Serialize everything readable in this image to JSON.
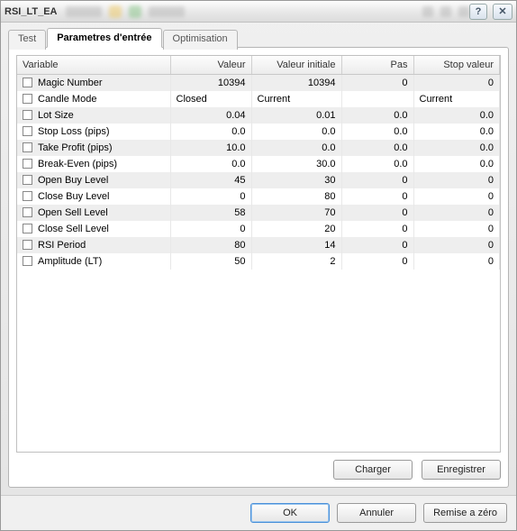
{
  "window": {
    "title": "RSI_LT_EA"
  },
  "tabs": {
    "test": "Test",
    "params": "Parametres d'entrée",
    "optim": "Optimisation"
  },
  "table": {
    "headers": {
      "variable": "Variable",
      "value": "Valeur",
      "initial": "Valeur initiale",
      "step": "Pas",
      "stop": "Stop valeur"
    },
    "rows": [
      {
        "name": "Magic Number",
        "value": "10394",
        "initial": "10394",
        "step": "0",
        "stop": "0"
      },
      {
        "name": "Candle Mode",
        "value": "Closed",
        "initial": "Current",
        "step": "",
        "stop": "Current"
      },
      {
        "name": "Lot Size",
        "value": "0.04",
        "initial": "0.01",
        "step": "0.0",
        "stop": "0.0"
      },
      {
        "name": "Stop Loss (pips)",
        "value": "0.0",
        "initial": "0.0",
        "step": "0.0",
        "stop": "0.0"
      },
      {
        "name": "Take Profit (pips)",
        "value": "10.0",
        "initial": "0.0",
        "step": "0.0",
        "stop": "0.0"
      },
      {
        "name": "Break-Even (pips)",
        "value": "0.0",
        "initial": "30.0",
        "step": "0.0",
        "stop": "0.0"
      },
      {
        "name": "Open Buy Level",
        "value": "45",
        "initial": "30",
        "step": "0",
        "stop": "0"
      },
      {
        "name": "Close Buy Level",
        "value": "0",
        "initial": "80",
        "step": "0",
        "stop": "0"
      },
      {
        "name": "Open Sell Level",
        "value": "58",
        "initial": "70",
        "step": "0",
        "stop": "0"
      },
      {
        "name": "Close Sell Level",
        "value": "0",
        "initial": "20",
        "step": "0",
        "stop": "0"
      },
      {
        "name": "RSI Period",
        "value": "80",
        "initial": "14",
        "step": "0",
        "stop": "0"
      },
      {
        "name": "Amplitude (LT)",
        "value": "50",
        "initial": "2",
        "step": "0",
        "stop": "0"
      }
    ]
  },
  "buttons": {
    "load": "Charger",
    "save": "Enregistrer",
    "ok": "OK",
    "cancel": "Annuler",
    "reset": "Remise a zéro"
  },
  "icons": {
    "help": "?",
    "close": "✕"
  }
}
